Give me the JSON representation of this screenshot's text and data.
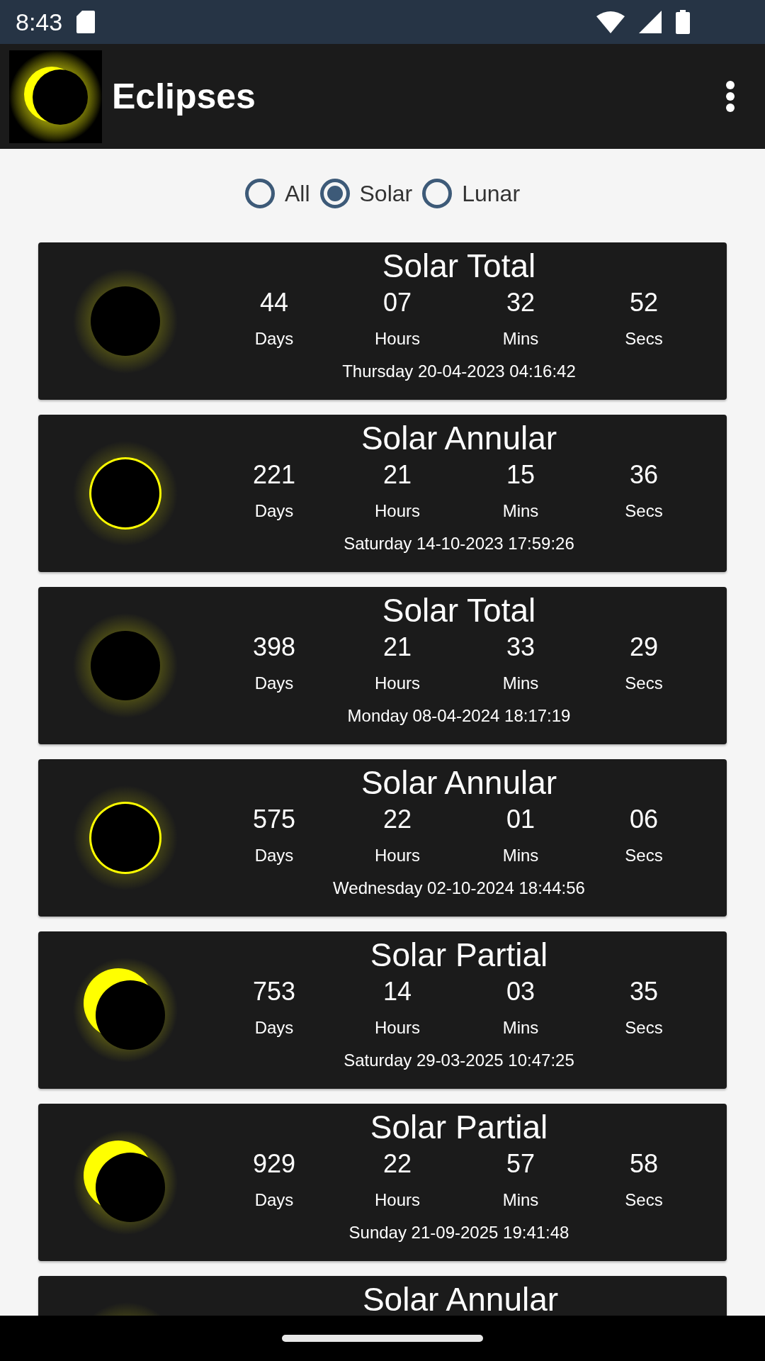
{
  "status_bar": {
    "time": "8:43"
  },
  "app_bar": {
    "title": "Eclipses"
  },
  "filter": [
    {
      "label": "All",
      "selected": false
    },
    {
      "label": "Solar",
      "selected": true
    },
    {
      "label": "Lunar",
      "selected": false
    }
  ],
  "eclipses": [
    {
      "kind": "total",
      "title": "Solar Total",
      "counts": [
        {
          "value": "44",
          "unit": "Days"
        },
        {
          "value": "07",
          "unit": "Hours"
        },
        {
          "value": "32",
          "unit": "Mins"
        },
        {
          "value": "52",
          "unit": "Secs"
        }
      ],
      "date": "Thursday 20-04-2023 04:16:42"
    },
    {
      "kind": "annular",
      "title": "Solar Annular",
      "counts": [
        {
          "value": "221",
          "unit": "Days"
        },
        {
          "value": "21",
          "unit": "Hours"
        },
        {
          "value": "15",
          "unit": "Mins"
        },
        {
          "value": "36",
          "unit": "Secs"
        }
      ],
      "date": "Saturday 14-10-2023 17:59:26"
    },
    {
      "kind": "total",
      "title": "Solar Total",
      "counts": [
        {
          "value": "398",
          "unit": "Days"
        },
        {
          "value": "21",
          "unit": "Hours"
        },
        {
          "value": "33",
          "unit": "Mins"
        },
        {
          "value": "29",
          "unit": "Secs"
        }
      ],
      "date": "Monday 08-04-2024 18:17:19"
    },
    {
      "kind": "annular",
      "title": "Solar Annular",
      "counts": [
        {
          "value": "575",
          "unit": "Days"
        },
        {
          "value": "22",
          "unit": "Hours"
        },
        {
          "value": "01",
          "unit": "Mins"
        },
        {
          "value": "06",
          "unit": "Secs"
        }
      ],
      "date": "Wednesday 02-10-2024 18:44:56"
    },
    {
      "kind": "partial",
      "title": "Solar Partial",
      "counts": [
        {
          "value": "753",
          "unit": "Days"
        },
        {
          "value": "14",
          "unit": "Hours"
        },
        {
          "value": "03",
          "unit": "Mins"
        },
        {
          "value": "35",
          "unit": "Secs"
        }
      ],
      "date": "Saturday 29-03-2025 10:47:25"
    },
    {
      "kind": "partial",
      "title": "Solar Partial",
      "counts": [
        {
          "value": "929",
          "unit": "Days"
        },
        {
          "value": "22",
          "unit": "Hours"
        },
        {
          "value": "57",
          "unit": "Mins"
        },
        {
          "value": "58",
          "unit": "Secs"
        }
      ],
      "date": "Sunday 21-09-2025 19:41:48"
    },
    {
      "kind": "annular",
      "title": "Solar Annular"
    }
  ]
}
